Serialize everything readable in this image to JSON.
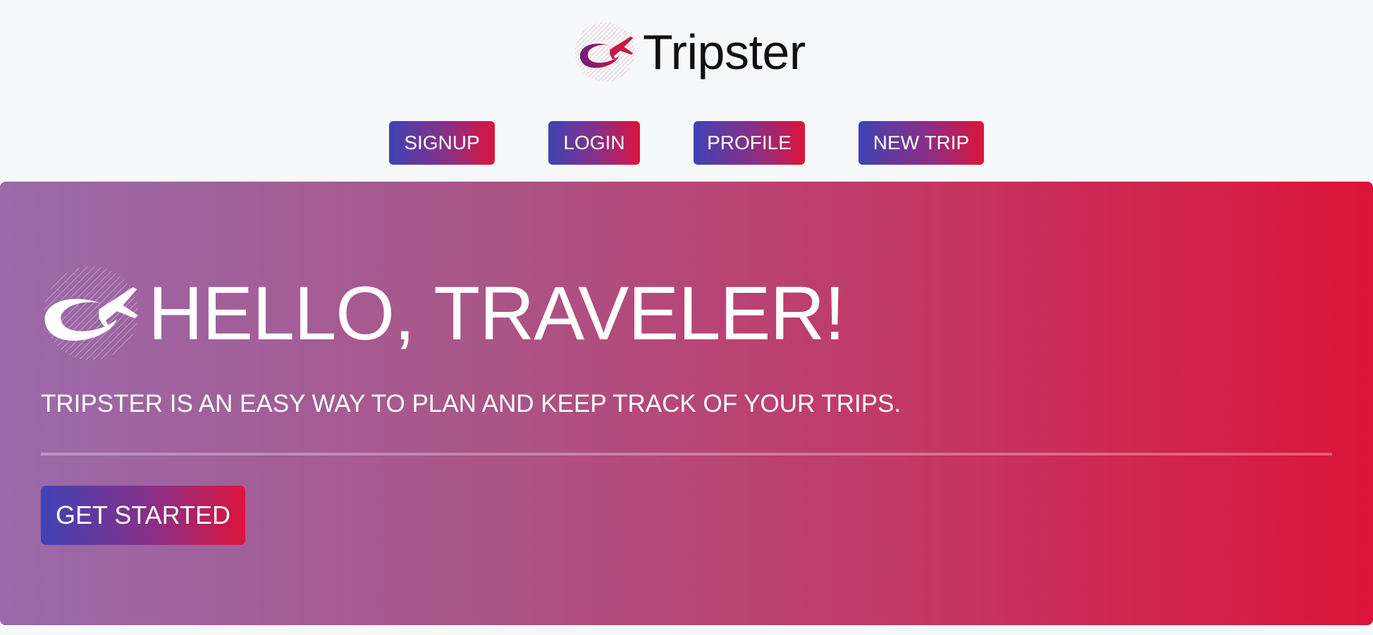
{
  "brand": {
    "name": "Tripster",
    "logo_icon": "airplane-globe-icon"
  },
  "nav": {
    "items": [
      {
        "label": "SIGNUP"
      },
      {
        "label": "LOGIN"
      },
      {
        "label": "PROFILE"
      },
      {
        "label": "NEW TRIP"
      }
    ]
  },
  "hero": {
    "icon": "airplane-globe-icon",
    "title": "HELLO, TRAVELER!",
    "subtitle": "TRIPSTER IS AN EASY WAY TO PLAN AND KEEP TRACK OF YOUR TRIPS.",
    "cta_label": "GET STARTED"
  },
  "colors": {
    "button_gradient_start": "#3f42b5",
    "button_gradient_end": "#dc143c",
    "hero_gradient_start": "#9a6aaa",
    "hero_gradient_end": "#db1438",
    "page_background": "#f7f8fa"
  }
}
